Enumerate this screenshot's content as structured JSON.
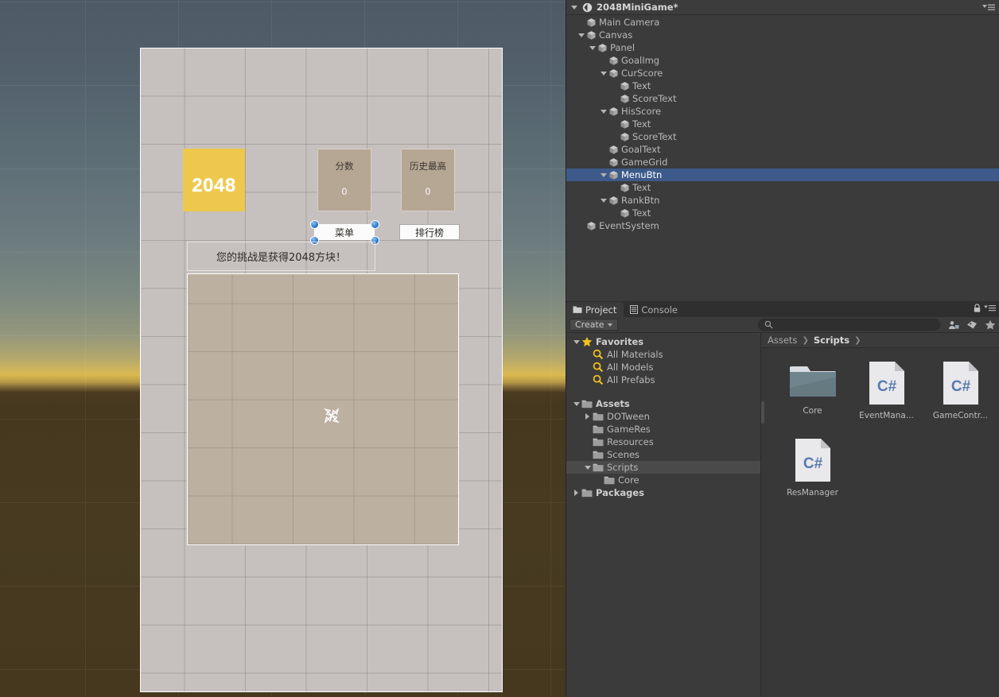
{
  "scene": {
    "canvas_label": "scene-canvas",
    "goal_tile": {
      "value": "2048"
    },
    "cur_score": {
      "label": "分数",
      "value": "0"
    },
    "his_score": {
      "label": "历史最高",
      "value": "0"
    },
    "menu_button": {
      "label": "菜单"
    },
    "rank_button": {
      "label": "排行榜"
    },
    "goal_text": "您的挑战是获得2048方块！",
    "colors": {
      "goal_tile": "#edc84d",
      "score_box": "#b6a694",
      "game_grid": "#bcb0a1",
      "canvas_bg": "#c6c0be",
      "selection_handle": "#2f7fd1"
    }
  },
  "hierarchy": {
    "title": "2048MiniGame*",
    "menu_icon": "hamburger-menu-icon",
    "rows": [
      {
        "label": "Main Camera",
        "depth": 1,
        "arrow": "none",
        "selected": false
      },
      {
        "label": "Canvas",
        "depth": 1,
        "arrow": "down",
        "selected": false
      },
      {
        "label": "Panel",
        "depth": 2,
        "arrow": "down",
        "selected": false
      },
      {
        "label": "GoalImg",
        "depth": 3,
        "arrow": "none",
        "selected": false
      },
      {
        "label": "CurScore",
        "depth": 3,
        "arrow": "down",
        "selected": false
      },
      {
        "label": "Text",
        "depth": 4,
        "arrow": "none",
        "selected": false
      },
      {
        "label": "ScoreText",
        "depth": 4,
        "arrow": "none",
        "selected": false
      },
      {
        "label": "HisScore",
        "depth": 3,
        "arrow": "down",
        "selected": false
      },
      {
        "label": "Text",
        "depth": 4,
        "arrow": "none",
        "selected": false
      },
      {
        "label": "ScoreText",
        "depth": 4,
        "arrow": "none",
        "selected": false
      },
      {
        "label": "GoalText",
        "depth": 3,
        "arrow": "none",
        "selected": false
      },
      {
        "label": "GameGrid",
        "depth": 3,
        "arrow": "none",
        "selected": false
      },
      {
        "label": "MenuBtn",
        "depth": 3,
        "arrow": "down",
        "selected": true
      },
      {
        "label": "Text",
        "depth": 4,
        "arrow": "none",
        "selected": false
      },
      {
        "label": "RankBtn",
        "depth": 3,
        "arrow": "down",
        "selected": false
      },
      {
        "label": "Text",
        "depth": 4,
        "arrow": "none",
        "selected": false
      },
      {
        "label": "EventSystem",
        "depth": 1,
        "arrow": "none",
        "selected": false
      }
    ]
  },
  "project": {
    "tabs": [
      {
        "label": "Project",
        "icon": "folder-icon",
        "active": true
      },
      {
        "label": "Console",
        "icon": "console-icon",
        "active": false
      }
    ],
    "toolbar": {
      "create_label": "Create",
      "search_placeholder": "",
      "search_value": "",
      "search_icon": "search-icon",
      "icons": [
        "person-filter-icon",
        "tag-filter-icon",
        "star-filter-icon"
      ],
      "lock_icon": "lock-icon",
      "menu_icon": "hamburger-menu-icon"
    },
    "tree": [
      {
        "label": "Favorites",
        "depth": 0,
        "arrow": "down",
        "icon": "star-icon",
        "bold": true,
        "sel": false
      },
      {
        "label": "All Materials",
        "depth": 1,
        "arrow": "none",
        "icon": "search-icon",
        "bold": false,
        "sel": false
      },
      {
        "label": "All Models",
        "depth": 1,
        "arrow": "none",
        "icon": "search-icon",
        "bold": false,
        "sel": false
      },
      {
        "label": "All Prefabs",
        "depth": 1,
        "arrow": "none",
        "icon": "search-icon",
        "bold": false,
        "sel": false
      },
      {
        "label": "SPACER",
        "depth": 0,
        "arrow": "none",
        "icon": "none",
        "bold": false,
        "sel": false
      },
      {
        "label": "Assets",
        "depth": 0,
        "arrow": "down",
        "icon": "folder-icon",
        "bold": true,
        "sel": false
      },
      {
        "label": "DOTween",
        "depth": 1,
        "arrow": "right",
        "icon": "folder-icon",
        "bold": false,
        "sel": false
      },
      {
        "label": "GameRes",
        "depth": 1,
        "arrow": "none",
        "icon": "folder-icon",
        "bold": false,
        "sel": false
      },
      {
        "label": "Resources",
        "depth": 1,
        "arrow": "none",
        "icon": "folder-icon",
        "bold": false,
        "sel": false
      },
      {
        "label": "Scenes",
        "depth": 1,
        "arrow": "none",
        "icon": "folder-icon",
        "bold": false,
        "sel": false
      },
      {
        "label": "Scripts",
        "depth": 1,
        "arrow": "down",
        "icon": "folder-icon",
        "bold": false,
        "sel": true
      },
      {
        "label": "Core",
        "depth": 2,
        "arrow": "none",
        "icon": "folder-icon",
        "bold": false,
        "sel": false
      },
      {
        "label": "Packages",
        "depth": 0,
        "arrow": "right",
        "icon": "folder-icon",
        "bold": true,
        "sel": false
      }
    ],
    "breadcrumb": [
      "Assets",
      "Scripts"
    ],
    "assets": [
      {
        "name": "Core",
        "type": "folder"
      },
      {
        "name": "EventMana...",
        "type": "csharp"
      },
      {
        "name": "GameContr...",
        "type": "csharp"
      },
      {
        "name": "ResManager",
        "type": "csharp"
      }
    ]
  }
}
